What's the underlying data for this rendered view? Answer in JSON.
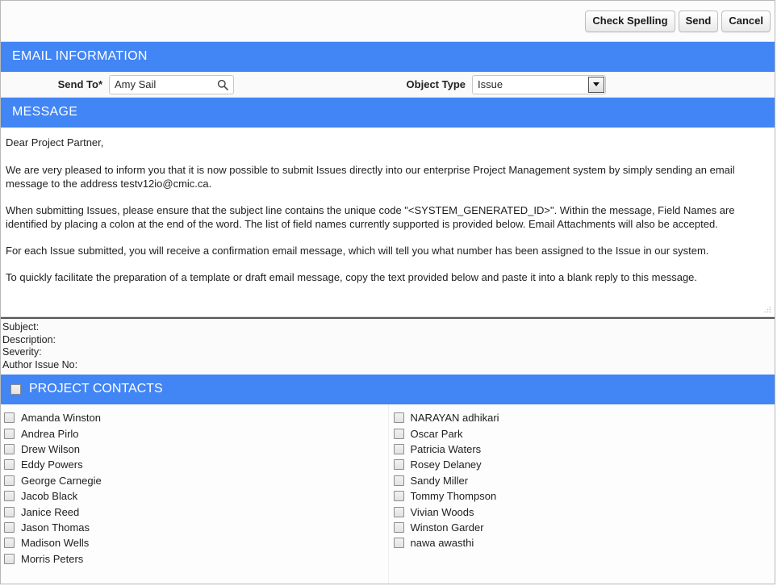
{
  "toolbar": {
    "buttons": [
      {
        "label": "Check Spelling",
        "name": "check-spelling-button"
      },
      {
        "label": "Send",
        "name": "send-button"
      },
      {
        "label": "Cancel",
        "name": "cancel-button"
      }
    ]
  },
  "email_information": {
    "header": "EMAIL INFORMATION",
    "send_to": {
      "label": "Send To",
      "required_marker": "*",
      "value": "Amy Sail",
      "placeholder": "",
      "icon": "search-icon"
    },
    "object_type": {
      "label": "Object Type",
      "value": "Issue",
      "icon": "chevron-down-icon"
    }
  },
  "message": {
    "header": "MESSAGE",
    "paragraphs": [
      "Dear Project Partner,",
      "We are very pleased to inform you that it is now possible to submit Issues directly into our enterprise Project Management system by simply sending an email message to the address testv12io@cmic.ca.",
      "When submitting Issues, please ensure that the subject line contains the unique code \"<SYSTEM_GENERATED_ID>\".  Within the message, Field Names are identified by placing a colon at the end of the word.  The list of field names currently supported is provided below.  Email Attachments will also be accepted.",
      "For each Issue submitted, you will receive a confirmation email message, which will tell you what number has been assigned to the Issue in our system.",
      "To quickly facilitate the preparation of a template or draft email message, copy the text provided below and paste it into a blank reply to this message."
    ],
    "field_names": [
      "Subject:",
      "Description:",
      "Severity:",
      "Author Issue No:"
    ]
  },
  "project_contacts": {
    "header": "PROJECT CONTACTS",
    "select_all_checked": false,
    "left_column": [
      {
        "name": "Amanda Winston",
        "checked": false
      },
      {
        "name": "Andrea Pirlo",
        "checked": false
      },
      {
        "name": "Drew Wilson",
        "checked": false
      },
      {
        "name": "Eddy Powers",
        "checked": false
      },
      {
        "name": "George Carnegie",
        "checked": false
      },
      {
        "name": "Jacob Black",
        "checked": false
      },
      {
        "name": "Janice Reed",
        "checked": false
      },
      {
        "name": "Jason Thomas",
        "checked": false
      },
      {
        "name": "Madison Wells",
        "checked": false
      },
      {
        "name": "Morris Peters",
        "checked": false
      }
    ],
    "right_column": [
      {
        "name": "NARAYAN adhikari",
        "checked": false
      },
      {
        "name": "Oscar Park",
        "checked": false
      },
      {
        "name": "Patricia Waters",
        "checked": false
      },
      {
        "name": "Rosey Delaney",
        "checked": false
      },
      {
        "name": "Sandy Miller",
        "checked": false
      },
      {
        "name": "Tommy Thompson",
        "checked": false
      },
      {
        "name": "Vivian Woods",
        "checked": false
      },
      {
        "name": "Winston Garder",
        "checked": false
      },
      {
        "name": "nawa awasthi",
        "checked": false
      }
    ]
  },
  "colors": {
    "header_blue": "#4285f4",
    "header_text": "#ffffff",
    "body_text": "#1e1e1e",
    "border": "#c6c6c6"
  }
}
